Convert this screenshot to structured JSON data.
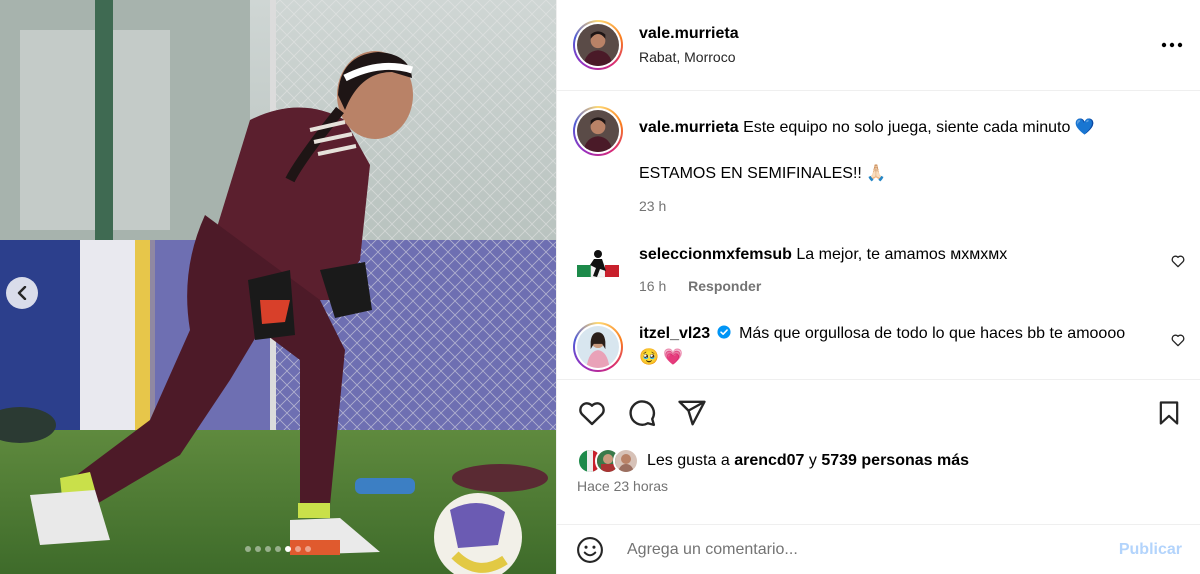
{
  "post": {
    "author": "vale.murrieta",
    "location": "Rabat, Morroco",
    "carousel": {
      "slide_count": 7,
      "active_index": 4
    }
  },
  "caption": {
    "username": "vale.murrieta",
    "text": "Este equipo no solo juega, siente cada minuto",
    "emoji": "💙",
    "line2": "ESTAMOS EN SEMIFINALES!!",
    "line2_emoji": "🙏🏻",
    "time": "23 h"
  },
  "comments": [
    {
      "username": "seleccionmxfemsub",
      "text": "La mejor, te amamos мхмхмх",
      "time": "16 h",
      "reply_label": "Responder"
    },
    {
      "username": "itzel_vl23",
      "verified": true,
      "text": "Más que orgullosa de todo lo que haces bb te amoooo",
      "emoji": "🥹 💗"
    }
  ],
  "likes": {
    "prefix": "Les gusta a",
    "first_user": "arencd07",
    "connector": "y",
    "others": "5739 personas más"
  },
  "posted_ago": "Hace 23 horas",
  "comment_box": {
    "placeholder": "Agrega un comentario...",
    "publish_label": "Publicar"
  },
  "colors": {
    "publish_disabled": "#b3d4fc",
    "secondary_text": "#737373",
    "divider": "#efefef"
  }
}
